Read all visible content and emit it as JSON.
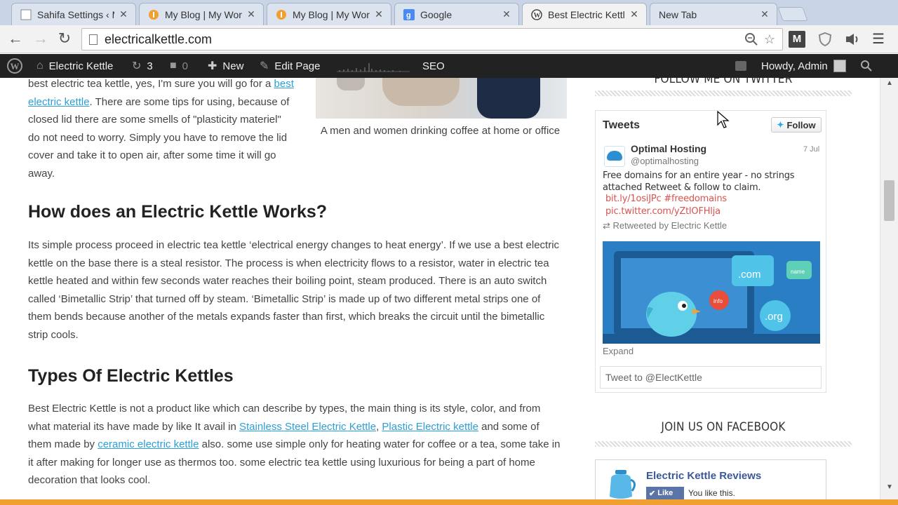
{
  "browser": {
    "tabs": [
      {
        "title": "Sahifa Settings ‹ M",
        "icon": "wordpress-icon",
        "active": false
      },
      {
        "title": "My Blog | My Wor",
        "icon": "blog-orange-icon",
        "active": false
      },
      {
        "title": "My Blog | My Wor",
        "icon": "blog-orange-icon",
        "active": false
      },
      {
        "title": "Google",
        "icon": "google-icon",
        "active": false
      },
      {
        "title": "Best Electric Kettle",
        "icon": "wordpress-icon",
        "active": true
      },
      {
        "title": "New Tab",
        "icon": "",
        "active": false
      }
    ],
    "close_glyph": "✕",
    "url": "electricalkettle.com"
  },
  "adminbar": {
    "site_name": "Electric Kettle",
    "updates": "3",
    "comments": "0",
    "new_label": "New",
    "edit_label": "Edit Page",
    "seo_label": "SEO",
    "howdy": "Howdy, Admin"
  },
  "article": {
    "intro_pre": "best electric tea kettle, yes, I'm sure you will go for a ",
    "intro_link": "best electric kettle",
    "intro_post": ". There are some tips for using, because of closed lid there are some smells of \"plasticity materiel\" do not need to worry. Simply you have to remove the lid cover and take it to open air, after some time it will go away.",
    "caption": "A men and women drinking coffee at home or office",
    "h_works": "How does an Electric Kettle Works?",
    "works_text": "Its simple process proceed in electric tea kettle  ‘electrical energy changes to heat energy’. If we use a best electric kettle on the base there is a steal resistor. The process is when electricity flows to a resistor, water in electric tea kettle heated and within few seconds water reaches their boiling point, steam produced. There is an auto switch called ‘Bimetallic Strip’ that turned off by steam. ‘Bimetallic Strip’ is made up of two different metal strips one of them bends because another of the metals expands faster than first, which breaks the circuit until the bimetallic strip cools.",
    "h_types": "Types Of Electric Kettles",
    "types_pre": "Best Electric Kettle is not a product like which can describe by types, the main thing is its style, color, and from what material its have made by like It avail in ",
    "types_link1": "Stainless Steel Electric Kettle",
    "types_sep": ", ",
    "types_link2": "Plastic Electric kettle",
    "types_mid": " and some of them made by ",
    "types_link3": "ceramic electric kettle",
    "types_post": " also. some use simple only for heating water for coffee or a tea, some take in it after making for longer use as thermos too. some electric tea kettle using luxurious for being a part of home decoration that looks cool."
  },
  "sidebar": {
    "follow_heading": "FOLLOW ME ON TWITTER",
    "twitter": {
      "header": "Tweets",
      "follow_label": "Follow",
      "author_name": "Optimal Hosting",
      "author_handle": "@optimalhosting",
      "date": "7 Jul",
      "text": "Free domains for an entire year - no strings attached Retweet & follow to claim.",
      "link1": "bit.ly/1osiJPc #freedomains",
      "link2": "pic.twitter.com/yZtlOFHlja",
      "retweeted_by": "Retweeted by Electric Kettle",
      "image_labels": {
        "com": ".com",
        "org": ".org",
        "info": "info",
        "name": "name"
      },
      "expand": "Expand",
      "tweet_to": "Tweet to @ElectKettle"
    },
    "facebook_heading": "JOIN US ON FACEBOOK",
    "facebook": {
      "page_name": "Electric Kettle Reviews",
      "like_label": "Like",
      "you_like": "You like this."
    }
  }
}
